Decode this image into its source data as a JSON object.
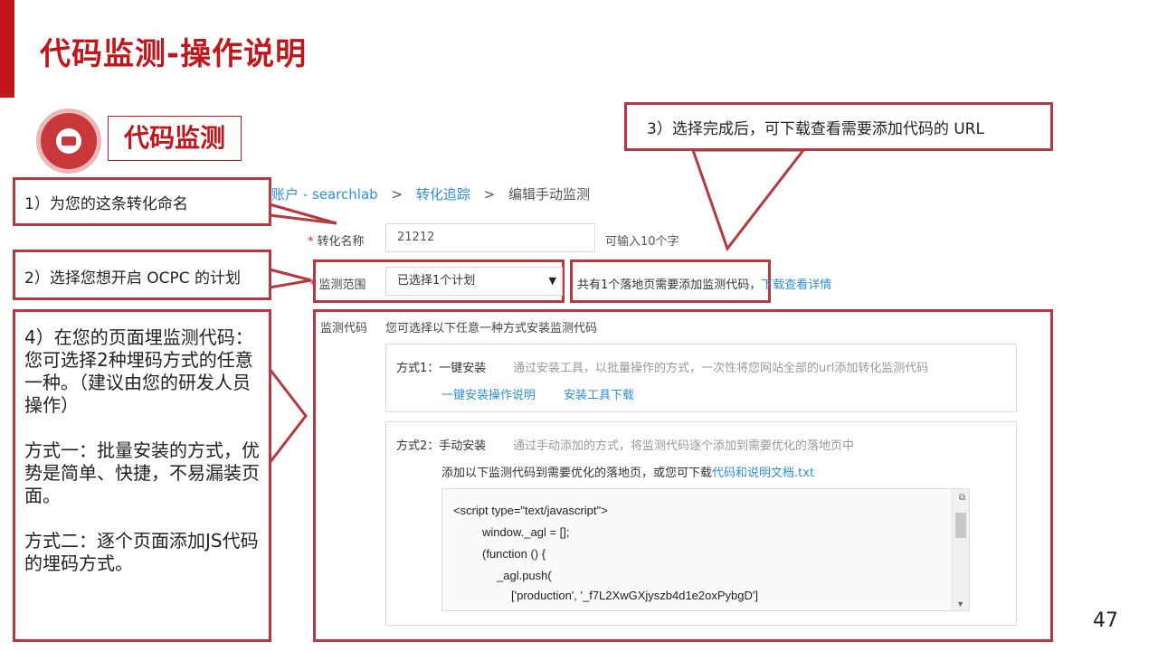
{
  "slide": {
    "title": "代码监测-操作说明",
    "section_label": "代码监测",
    "page_number": "47",
    "accent_color": "#c0171c"
  },
  "callouts": {
    "step1": "1）为您的这条转化命名",
    "step2": "2）选择您想开启 OCPC 的计划",
    "step3": "3）选择完成后，可下载查看需要添加代码的 URL",
    "step4": {
      "line1": "4）在您的页面埋监测代码：",
      "line2": "您可选择2种埋码方式的任意一种。（建议由您的研发人员操作）",
      "line3": "方式一：批量安装的方式，优势是简单、快捷，不易漏装页面。",
      "line4": "方式二：逐个页面添加JS代码的埋码方式。"
    }
  },
  "breadcrumb": {
    "account": "账户 - searchlab",
    "sep1": ">",
    "conversion": "转化追踪",
    "sep2": ">",
    "current": "编辑手动监测"
  },
  "form": {
    "required_mark": "*",
    "name_label": "转化名称",
    "name_value": "21212",
    "name_hint": "可输入10个字",
    "scope_label": "监测范围",
    "scope_value": "已选择1个计划",
    "scope_info": "共有1个落地页需要添加监测代码，",
    "scope_link": "下载查看详情",
    "code_label": "监测代码",
    "code_intro": "您可选择以下任意一种方式安装监测代码"
  },
  "method1": {
    "title": "方式1：一键安装",
    "desc": "通过安装工具，以批量操作的方式，一次性将您网站全部的url添加转化监测代码",
    "link1": "一键安装操作说明",
    "link2": "安装工具下载"
  },
  "method2": {
    "title": "方式2：手动安装",
    "desc": "通过手动添加的方式，将监测代码逐个添加到需要优化的落地页中",
    "instruction": "添加以下监测代码到需要优化的落地页，或您可下载",
    "instruction_link": "代码和说明文档.txt",
    "code_lines": [
      "<script type=\"text/javascript\">",
      "window._agl = [];",
      "(function () {",
      "_agl.push(",
      "['production', '_f7L2XwGXjyszb4d1e2oxPybgD']",
      ");"
    ]
  }
}
